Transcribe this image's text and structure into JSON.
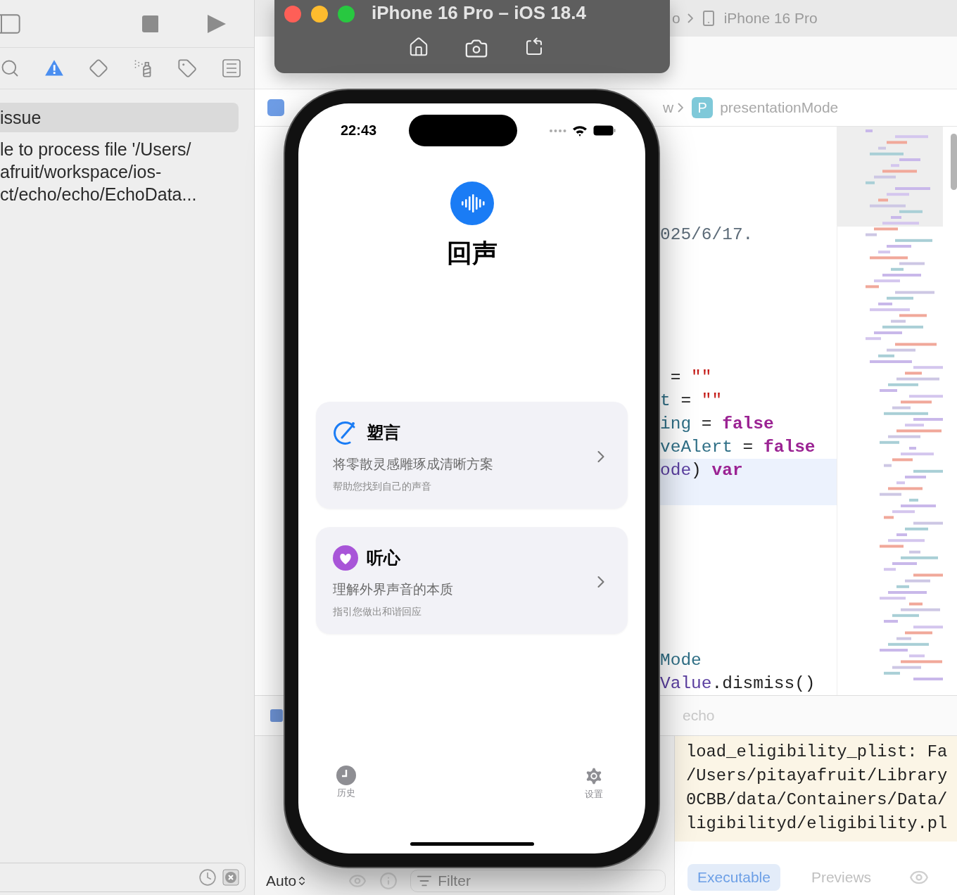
{
  "navigator": {
    "tabs": [
      {
        "selected": false
      },
      {
        "selected": true
      },
      {
        "selected": false
      },
      {
        "selected": false
      },
      {
        "selected": false
      },
      {
        "selected": false
      }
    ],
    "issue_group": {
      "label": "issue",
      "selected": true
    },
    "issue_message": [
      "le to process file '/Users/",
      "afruit/workspace/ios-",
      "ct/echo/echo/EchoData..."
    ]
  },
  "editor": {
    "path": [
      "o",
      "iPhone 16 Pro"
    ],
    "jump_bar": {
      "before": "w",
      "symbol_letter": "P",
      "symbol": "presentationMode"
    },
    "lines": [
      {
        "current": false,
        "tokens": [
          {
            "text": "025/6/17.",
            "kind": "comment"
          }
        ]
      },
      {
        "current": false,
        "tokens": [
          {
            "text": " = ",
            "kind": "plain"
          },
          {
            "text": "\"\"",
            "kind": "string"
          }
        ]
      },
      {
        "current": false,
        "tokens": [
          {
            "text": "t",
            "kind": "ident"
          },
          {
            "text": " = ",
            "kind": "plain"
          },
          {
            "text": "\"\"",
            "kind": "string"
          }
        ]
      },
      {
        "current": false,
        "tokens": [
          {
            "text": "ing",
            "kind": "ident"
          },
          {
            "text": " = ",
            "kind": "plain"
          },
          {
            "text": "false",
            "kind": "keyword"
          }
        ]
      },
      {
        "current": false,
        "tokens": [
          {
            "text": "veAlert",
            "kind": "ident"
          },
          {
            "text": " = ",
            "kind": "plain"
          },
          {
            "text": "false",
            "kind": "keyword"
          }
        ]
      },
      {
        "current": true,
        "tokens": [
          {
            "text": "ode",
            "kind": "type"
          },
          {
            "text": ") ",
            "kind": "plain"
          },
          {
            "text": "var",
            "kind": "keyword"
          }
        ]
      },
      {
        "current": false,
        "tokens": [
          {
            "text": "Mode",
            "kind": "ident"
          }
        ]
      },
      {
        "current": false,
        "tokens": [
          {
            "text": "Value",
            "kind": "type"
          },
          {
            "text": ".dismiss()",
            "kind": "plain"
          }
        ]
      }
    ]
  },
  "debug_bar": {
    "target": "echo"
  },
  "variables": {
    "mode": "Auto",
    "filter_placeholder": "Filter"
  },
  "console": {
    "lines": [
      "load_eligibility_plist: Fa",
      "/Users/pitayafruit/Library",
      "0CBB/data/Containers/Data/",
      "ligibilityd/eligibility.pl"
    ],
    "tabs": [
      {
        "label": "Executable",
        "selected": true
      },
      {
        "label": "Previews",
        "selected": false
      }
    ]
  },
  "simulator": {
    "title": "iPhone 16 Pro – iOS 18.4",
    "time": "22:43",
    "app_title": "回声",
    "cards": [
      {
        "kind": "pen",
        "color": "#1a7cf5",
        "title": "塑言",
        "subtitle": "将零散灵感雕琢成清晰方案",
        "caption": "帮助您找到自己的声音"
      },
      {
        "kind": "heart",
        "color": "#a855d8",
        "title": "听心",
        "subtitle": "理解外界声音的本质",
        "caption": "指引您做出和谐回应"
      }
    ],
    "tab_bar": [
      {
        "kind": "history",
        "label": "历史"
      },
      {
        "kind": "settings",
        "label": "设置"
      }
    ]
  }
}
